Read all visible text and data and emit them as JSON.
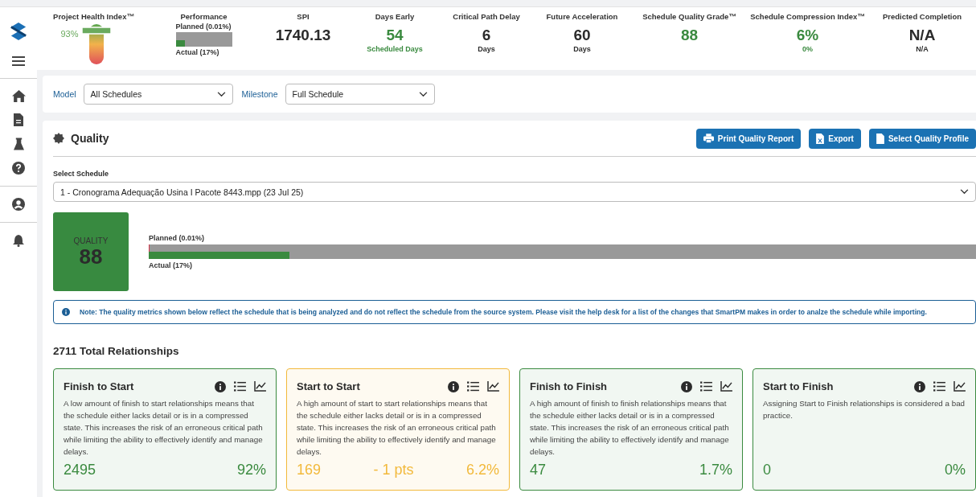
{
  "sidebar": {
    "items": [
      {
        "kind": "logo"
      },
      {
        "kind": "menu"
      },
      {
        "kind": "divider"
      },
      {
        "kind": "home"
      },
      {
        "kind": "document"
      },
      {
        "kind": "flask"
      },
      {
        "kind": "help"
      },
      {
        "kind": "divider"
      },
      {
        "kind": "user"
      },
      {
        "kind": "divider"
      },
      {
        "kind": "bell"
      }
    ]
  },
  "metrics": [
    {
      "kind": "gauge",
      "label": "Project Health Index™",
      "value": "93%"
    },
    {
      "kind": "performance",
      "label": "Performance",
      "planned": {
        "label": "Planned (0.01%)",
        "level": 0.0001
      },
      "actual": {
        "label": "Actual (17%)",
        "level": 0.17
      }
    },
    {
      "kind": "value",
      "label": "SPI",
      "value": "1740.13",
      "color": "#2b2b2b"
    },
    {
      "kind": "value",
      "label": "Days Early",
      "value": "54",
      "sub": "Scheduled Days",
      "color": "#3a8a3f"
    },
    {
      "kind": "value",
      "label": "Critical Path Delay",
      "value": "6",
      "sub": "Days",
      "color": "#2b2b2b"
    },
    {
      "kind": "value",
      "label": "Future Acceleration",
      "value": "60",
      "sub": "Days",
      "color": "#2b2b2b"
    },
    {
      "kind": "value",
      "label": "Schedule Quality Grade™",
      "value": "88",
      "color": "#3a8a3f"
    },
    {
      "kind": "value",
      "label": "Schedule Compression Index™",
      "value": "6%",
      "sub": "0%",
      "color": "#3a8a3f"
    },
    {
      "kind": "value",
      "label": "Predicted Completion",
      "value": "N/A",
      "sub": "N/A",
      "color": "#2b2b2b"
    }
  ],
  "filters": [
    {
      "label": "Model",
      "value": "All Schedules"
    },
    {
      "label": "Milestone",
      "value": "Full Schedule"
    }
  ],
  "quality": {
    "title": "Quality",
    "buttons": [
      {
        "kind": "print",
        "label": "Print Quality Report"
      },
      {
        "kind": "export",
        "label": "Export"
      },
      {
        "kind": "file",
        "label": "Select Quality Profile"
      }
    ],
    "select_label": "Select Schedule",
    "schedule": "1 - Cronograma Adequação Usina I Pacote 8443.mpp (23 Jul 25)",
    "score_label": "QUALITY",
    "score": "88",
    "planned": {
      "label": "Planned (0.01%)",
      "level": 0.0001
    },
    "actual": {
      "label": "Actual (17%)",
      "level": 0.17
    },
    "note": "Note: The quality metrics shown below reflect the schedule that is being analyzed and do not reflect the schedule from the source system. Please visit the help desk for a list of the changes that SmartPM makes in order to analze the schedule while importing.",
    "total": "2711 Total Relationships",
    "cards": [
      {
        "title": "Finish to Start",
        "color": "#3a8a3f",
        "description": "A low amount of finish to start relationships means that the schedule either lacks detail or is in a compressed state. This increases the risk of an erroneous critical path while limiting the ability to effectively identify and manage delays.",
        "count": "2495",
        "percent": "92%"
      },
      {
        "title": "Start to Start",
        "color": "#f2b93b",
        "description": "A high amount of start to start relationships means that the schedule either lacks detail or is in a compressed state. This increases the risk of an erroneous critical path while limiting the ability to effectively identify and manage delays.",
        "count": "169",
        "delta": "- 1 pts",
        "percent": "6.2%"
      },
      {
        "title": "Finish to Finish",
        "color": "#3a8a3f",
        "description": "A high amount of finish to finish relationships means that the schedule either lacks detail or is in a compressed state. This increases the risk of an erroneous critical path while limiting the ability to effectively identify and manage delays.",
        "count": "47",
        "percent": "1.7%"
      },
      {
        "title": "Start to Finish",
        "color": "#3a8a3f",
        "description": "Assigning Start to Finish relationships is considered a bad practice.",
        "count": "0",
        "percent": "0%"
      }
    ]
  }
}
